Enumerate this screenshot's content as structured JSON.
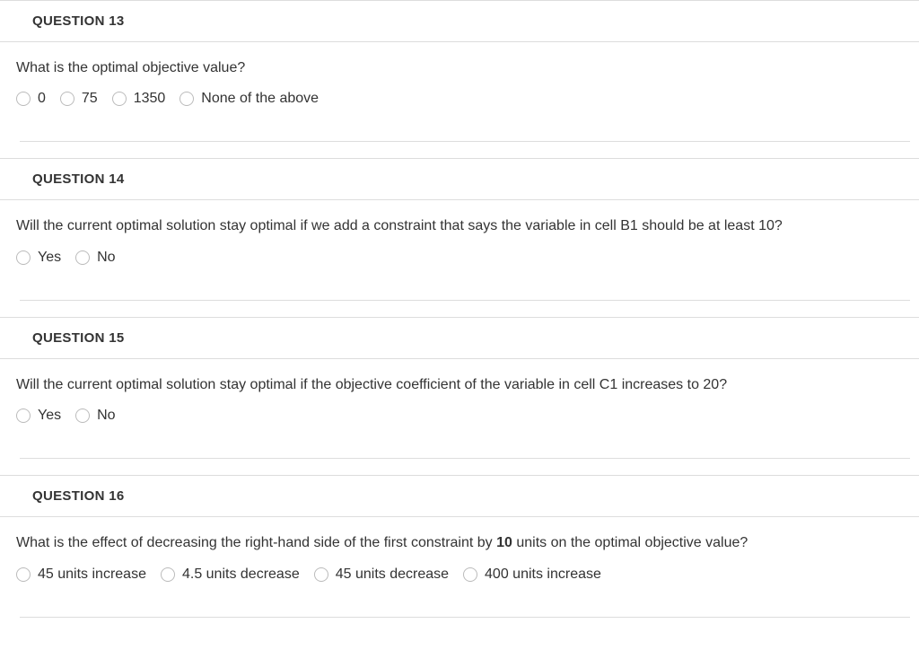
{
  "questions": [
    {
      "title": "QUESTION 13",
      "prompt": "What is the optimal objective value?",
      "options": [
        "0",
        "75",
        "1350",
        "None of the above"
      ]
    },
    {
      "title": "QUESTION 14",
      "prompt": "Will the current optimal solution stay optimal if we add a constraint that says the variable in cell B1 should be at least 10?",
      "options": [
        "Yes",
        "No"
      ]
    },
    {
      "title": "QUESTION 15",
      "prompt": "Will the current optimal solution stay optimal if the objective coefficient of the variable in cell C1 increases to 20?",
      "options": [
        "Yes",
        "No"
      ]
    },
    {
      "title": "QUESTION 16",
      "prompt_html": "What is the effect of decreasing the right-hand side of the first constraint by <strong>10</strong> units on the optimal objective value?",
      "options": [
        "45 units increase",
        "4.5 units decrease",
        "45 units decrease",
        "400 units increase"
      ]
    }
  ]
}
